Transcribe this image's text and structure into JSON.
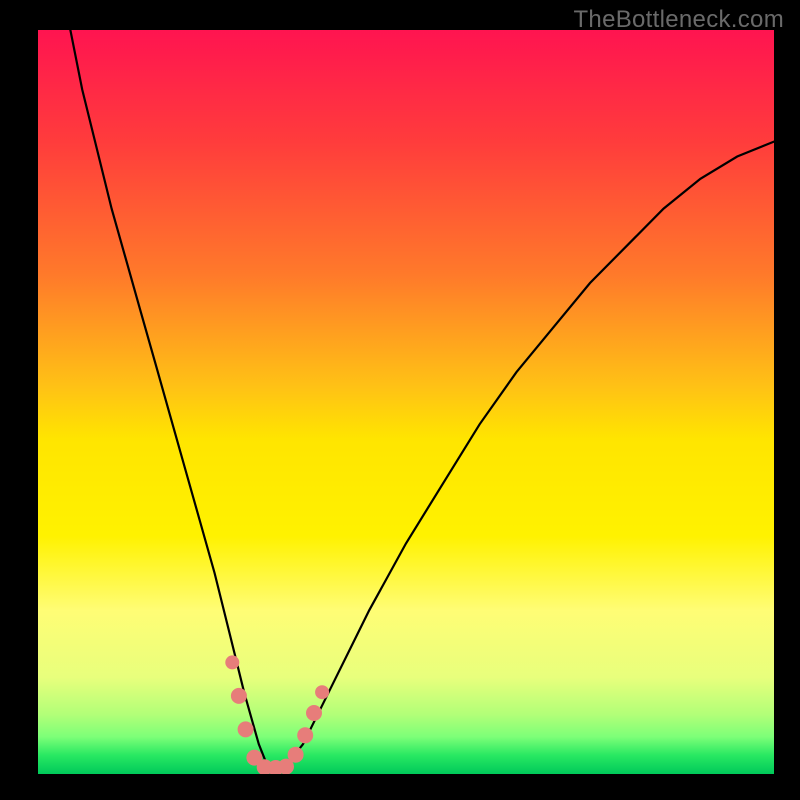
{
  "watermark": "TheBottleneck.com",
  "chart_data": {
    "type": "line",
    "title": "",
    "xlabel": "",
    "ylabel": "",
    "xlim": [
      0,
      100
    ],
    "ylim": [
      0,
      100
    ],
    "series": [
      {
        "name": "bottleneck-curve",
        "x": [
          4,
          6,
          8,
          10,
          12,
          14,
          16,
          18,
          20,
          22,
          24,
          26,
          28,
          30,
          31,
          32,
          33,
          34,
          36,
          40,
          45,
          50,
          55,
          60,
          65,
          70,
          75,
          80,
          85,
          90,
          95,
          100
        ],
        "values": [
          102,
          92,
          84,
          76,
          69,
          62,
          55,
          48,
          41,
          34,
          27,
          19,
          11,
          4,
          1.5,
          0.8,
          0.8,
          1.5,
          4,
          12,
          22,
          31,
          39,
          47,
          54,
          60,
          66,
          71,
          76,
          80,
          83,
          85
        ]
      }
    ],
    "markers": {
      "name": "highlight-points",
      "color": "#e77d7a",
      "points": [
        {
          "x": 26.4,
          "y": 15.0,
          "r": 7
        },
        {
          "x": 27.3,
          "y": 10.5,
          "r": 8
        },
        {
          "x": 28.2,
          "y": 6.0,
          "r": 8
        },
        {
          "x": 29.4,
          "y": 2.2,
          "r": 8
        },
        {
          "x": 30.8,
          "y": 0.9,
          "r": 8
        },
        {
          "x": 32.3,
          "y": 0.8,
          "r": 8
        },
        {
          "x": 33.7,
          "y": 1.0,
          "r": 8
        },
        {
          "x": 35.0,
          "y": 2.6,
          "r": 8
        },
        {
          "x": 36.3,
          "y": 5.2,
          "r": 8
        },
        {
          "x": 37.5,
          "y": 8.2,
          "r": 8
        },
        {
          "x": 38.6,
          "y": 11.0,
          "r": 7
        }
      ]
    },
    "gradient_stops": [
      {
        "pos": 0.0,
        "color": "#ff1450"
      },
      {
        "pos": 0.15,
        "color": "#ff3c3c"
      },
      {
        "pos": 0.33,
        "color": "#ff7a2a"
      },
      {
        "pos": 0.48,
        "color": "#ffc215"
      },
      {
        "pos": 0.55,
        "color": "#ffe500"
      },
      {
        "pos": 0.68,
        "color": "#fff200"
      },
      {
        "pos": 0.78,
        "color": "#fffd75"
      },
      {
        "pos": 0.87,
        "color": "#e8ff7c"
      },
      {
        "pos": 0.92,
        "color": "#b2ff78"
      },
      {
        "pos": 0.95,
        "color": "#7dff78"
      },
      {
        "pos": 0.975,
        "color": "#28e862"
      },
      {
        "pos": 1.0,
        "color": "#00c95a"
      }
    ]
  }
}
